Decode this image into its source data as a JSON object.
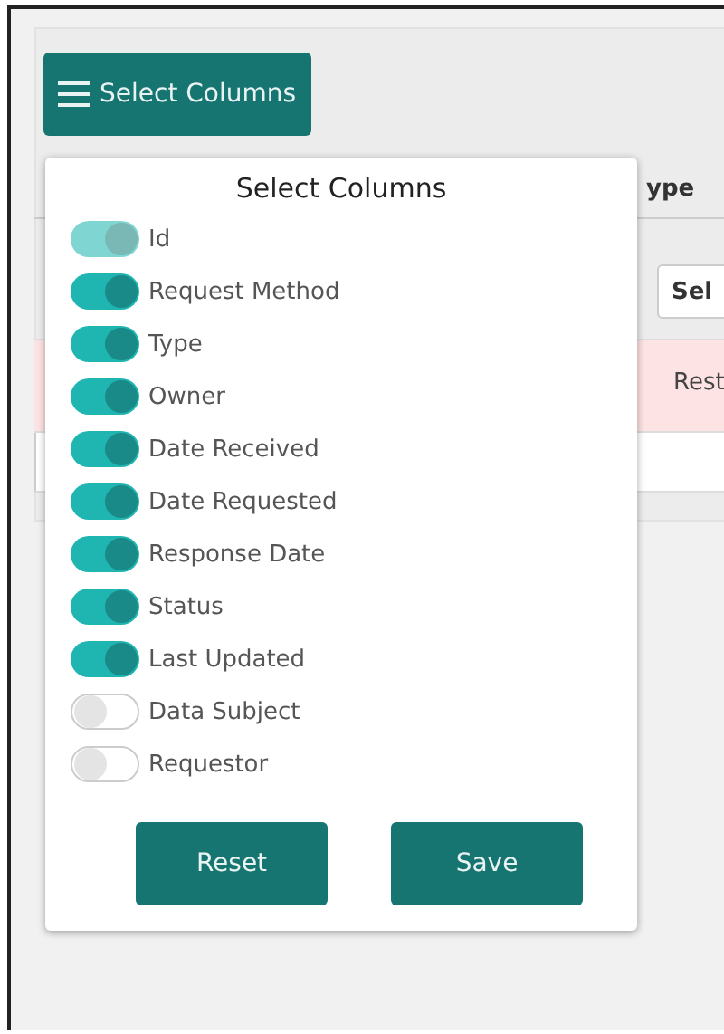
{
  "toolbar": {
    "select_columns_button": "Select Columns"
  },
  "table": {
    "header": "ype",
    "filter_placeholder": "Sel",
    "rows": [
      {
        "cell": "Rest",
        "highlighted": true
      },
      {
        "highlighted": false
      }
    ]
  },
  "popup": {
    "title": "Select Columns",
    "columns": [
      {
        "label": "Id",
        "on": true,
        "disabled": true
      },
      {
        "label": "Request Method",
        "on": true,
        "disabled": false
      },
      {
        "label": "Type",
        "on": true,
        "disabled": false
      },
      {
        "label": "Owner",
        "on": true,
        "disabled": false
      },
      {
        "label": "Date Received",
        "on": true,
        "disabled": false
      },
      {
        "label": "Date Requested",
        "on": true,
        "disabled": false
      },
      {
        "label": "Response Date",
        "on": true,
        "disabled": false
      },
      {
        "label": "Status",
        "on": true,
        "disabled": false
      },
      {
        "label": "Last Updated",
        "on": true,
        "disabled": false
      },
      {
        "label": "Data Subject",
        "on": false,
        "disabled": false
      },
      {
        "label": "Requestor",
        "on": false,
        "disabled": false
      }
    ],
    "buttons": [
      "Reset",
      "Save"
    ]
  }
}
